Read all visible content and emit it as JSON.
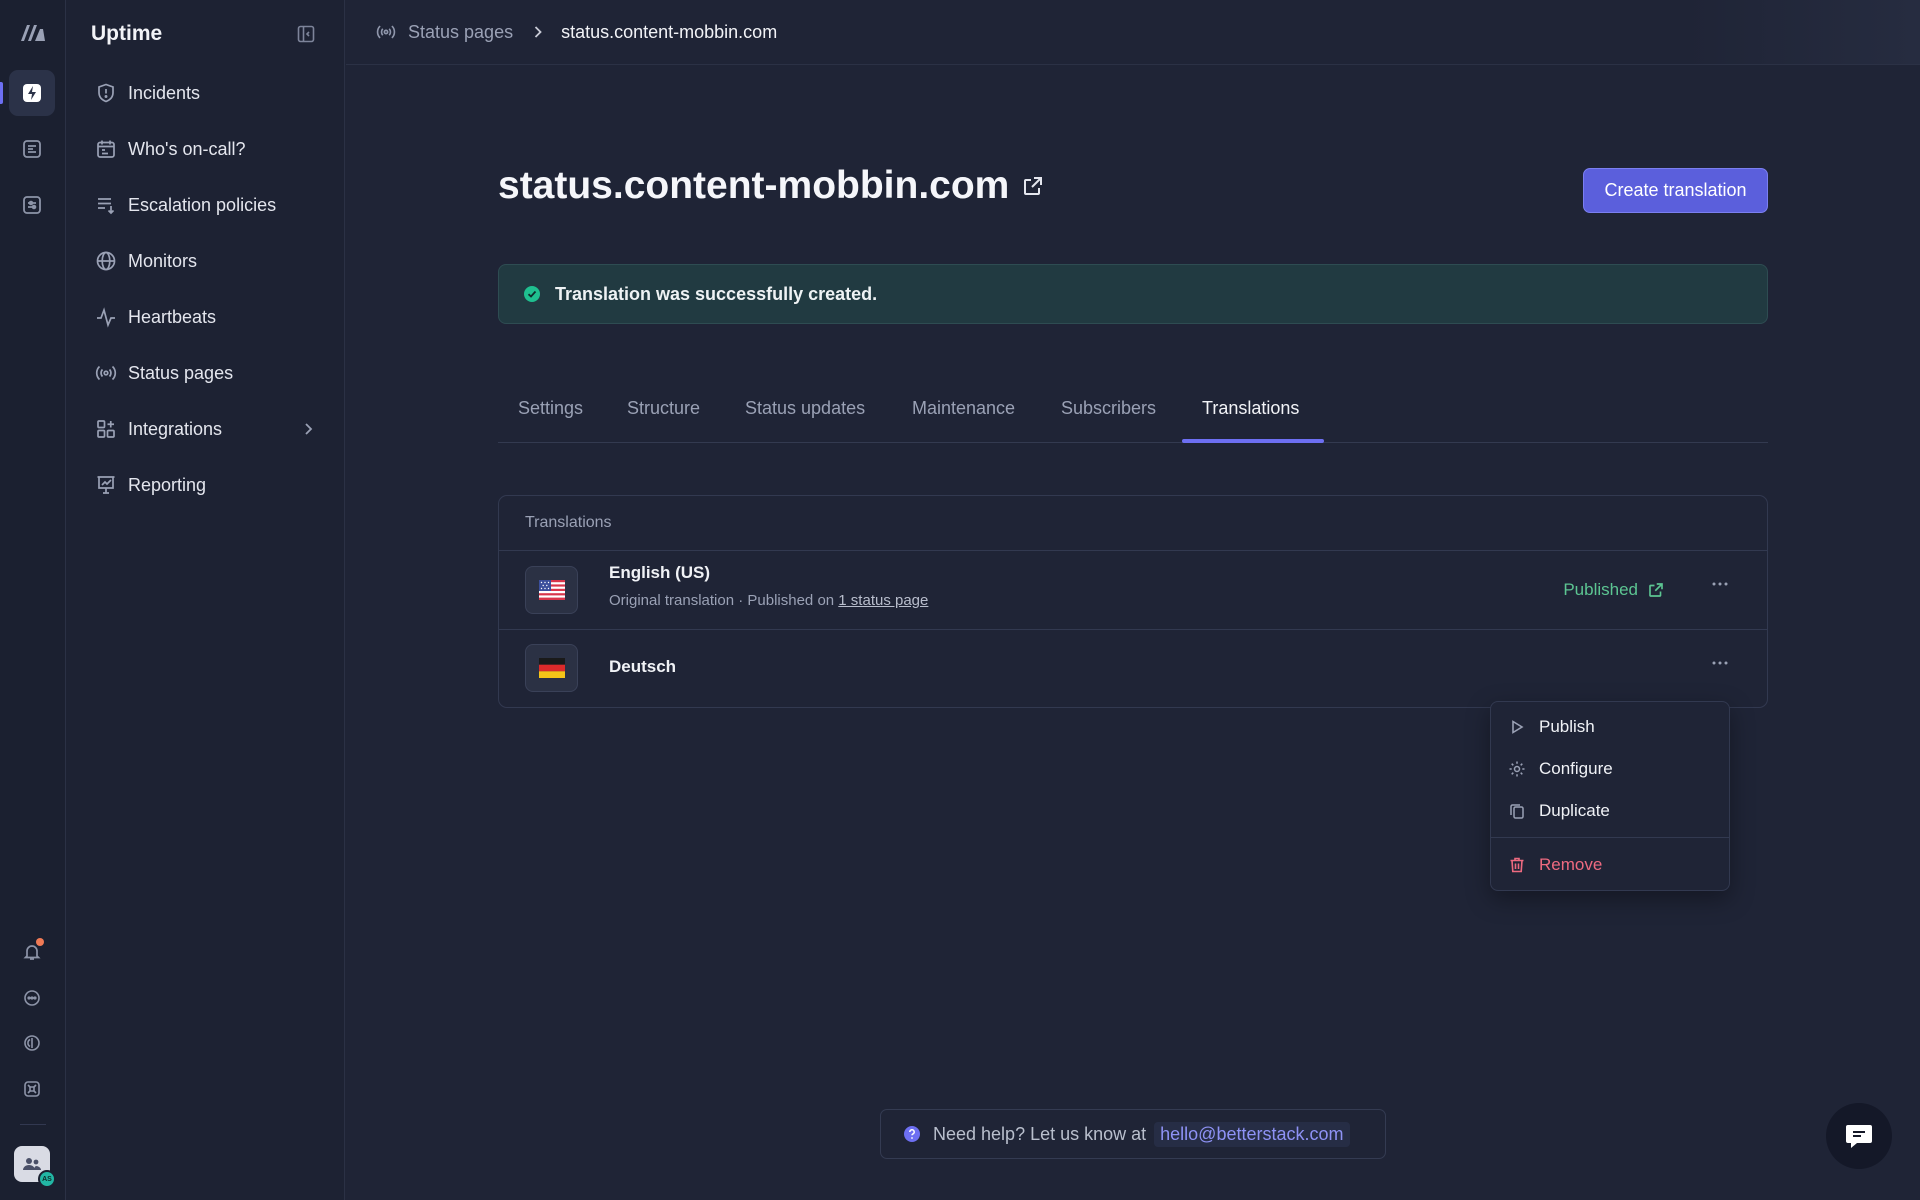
{
  "sidebar": {
    "title": "Uptime",
    "items": [
      {
        "label": "Incidents",
        "icon": "shield-icon"
      },
      {
        "label": "Who's on-call?",
        "icon": "calendar-icon"
      },
      {
        "label": "Escalation policies",
        "icon": "list-arrow-icon"
      },
      {
        "label": "Monitors",
        "icon": "globe-icon"
      },
      {
        "label": "Heartbeats",
        "icon": "pulse-icon"
      },
      {
        "label": "Status pages",
        "icon": "broadcast-icon"
      },
      {
        "label": "Integrations",
        "icon": "grid-plus-icon"
      },
      {
        "label": "Reporting",
        "icon": "presentation-chart-icon"
      }
    ]
  },
  "breadcrumb": {
    "parent": "Status pages",
    "current": "status.content-mobbin.com"
  },
  "page": {
    "title": "status.content-mobbin.com",
    "create_button": "Create translation"
  },
  "alert": {
    "message": "Translation was successfully created."
  },
  "tabs": [
    "Settings",
    "Structure",
    "Status updates",
    "Maintenance",
    "Subscribers",
    "Translations"
  ],
  "active_tab": "Translations",
  "translations": {
    "header": "Translations",
    "rows": [
      {
        "name": "English (US)",
        "sub_prefix": "Original translation · Published on ",
        "sub_link": "1 status page",
        "status": "Published",
        "flag": "us-flag"
      },
      {
        "name": "Deutsch",
        "flag": "de-flag"
      }
    ]
  },
  "context_menu": {
    "items": [
      {
        "label": "Publish",
        "icon": "play-icon"
      },
      {
        "label": "Configure",
        "icon": "gear-icon"
      },
      {
        "label": "Duplicate",
        "icon": "copy-icon"
      },
      {
        "label": "Remove",
        "icon": "trash-icon"
      }
    ]
  },
  "help": {
    "text": "Need help? Let us know at",
    "email": "hello@betterstack.com"
  },
  "user": {
    "initials": "AS"
  },
  "colors": {
    "accent": "#5b5fdc",
    "success": "#5cc592",
    "danger": "#ee6a80",
    "background": "#1f2436"
  }
}
